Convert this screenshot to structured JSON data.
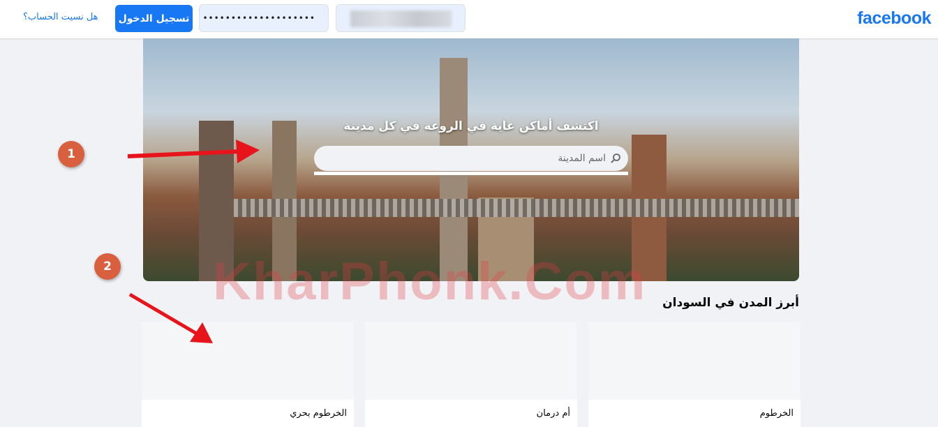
{
  "header": {
    "logo": "facebook",
    "password_value": "••••••••••••••••••••",
    "login_label": "تسجيل الدخول",
    "forgot_label": "هل نسيت الحساب؟"
  },
  "hero": {
    "title": "اكتشف أماكن غاية في الروعة في كل مدينة",
    "search_placeholder": "اسم المدينة"
  },
  "section": {
    "title": "أبرز المدن في السودان",
    "cities": [
      "الخرطوم",
      "أم درمان",
      "الخرطوم بحري"
    ]
  },
  "annotations": {
    "badges": [
      "1",
      "2"
    ],
    "watermark": "KharPhonk.Com",
    "arrow_color": "#e8141c",
    "badge_color": "#d9603e"
  },
  "colors": {
    "brand": "#1877f2"
  }
}
